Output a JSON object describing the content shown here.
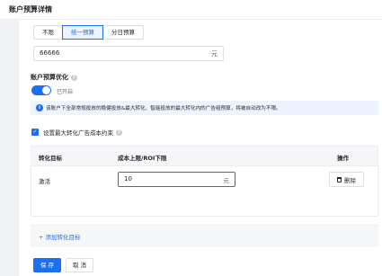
{
  "header": {
    "title": "账户预算详情"
  },
  "budget_type": {
    "options": [
      "不限",
      "统一预算",
      "分日预算"
    ],
    "selected": "统一预算"
  },
  "budget": {
    "value": "66666",
    "unit": "元"
  },
  "optimization": {
    "label": "账户预算优化",
    "toggle_on": true,
    "status": "已开启"
  },
  "info": {
    "text": "该账户下全部常规投放的稳健投放&最大转化、智能投放的最大转化内的广告组预算，将被自动改为不限。"
  },
  "cost_constraint": {
    "checked": true,
    "label": "设置最大转化广告成本约束"
  },
  "table": {
    "headers": {
      "goal": "转化目标",
      "cost": "成本上限/ROI下限",
      "action": "操作"
    },
    "rows": [
      {
        "goal": "激活",
        "value": "10",
        "unit": "元",
        "delete": "删除"
      }
    ]
  },
  "add_goal": "+ 添加转化目标",
  "actions": {
    "save": "保 存",
    "cancel": "取 消"
  },
  "colors": {
    "primary": "#1d6ff2",
    "info_bg": "#eef4ff"
  }
}
